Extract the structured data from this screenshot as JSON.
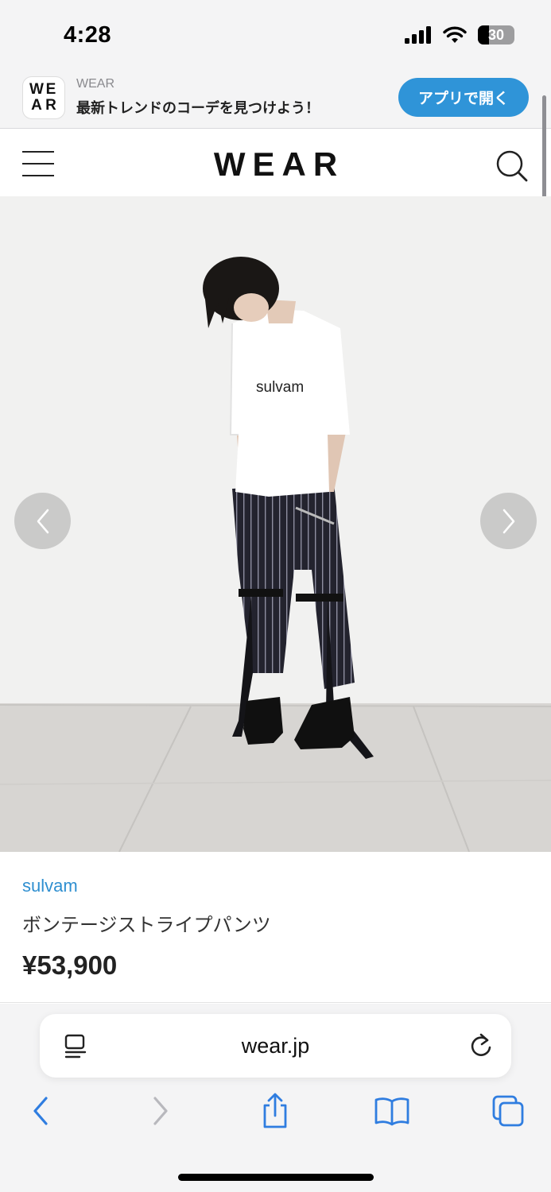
{
  "status_bar": {
    "time": "4:28",
    "battery": "30",
    "icons": [
      "cellular-signal-icon",
      "wifi-icon",
      "battery-icon"
    ]
  },
  "app_banner": {
    "logo_letters": [
      "W",
      "E",
      "A",
      "R"
    ],
    "app_name": "WEAR",
    "tagline": "最新トレンドのコーデを見つけよう！",
    "open_button": "アプリで開く",
    "accent_color": "#2f94d8"
  },
  "header": {
    "logo": "WEAR",
    "icons": [
      "hamburger-menu-icon",
      "search-icon"
    ]
  },
  "hero": {
    "tshirt_print": "sulvam",
    "controls": [
      "chevron-left-icon",
      "chevron-right-icon"
    ]
  },
  "product": {
    "brand": "sulvam",
    "name": "ボンテージストライプパンツ",
    "price": "¥53,900",
    "brand_color": "#2f8fd0"
  },
  "browser": {
    "url": "wear.jp",
    "icons": [
      "reader-view-icon",
      "reload-icon",
      "back-icon",
      "forward-icon",
      "share-icon",
      "bookmarks-icon",
      "tabs-icon"
    ]
  }
}
